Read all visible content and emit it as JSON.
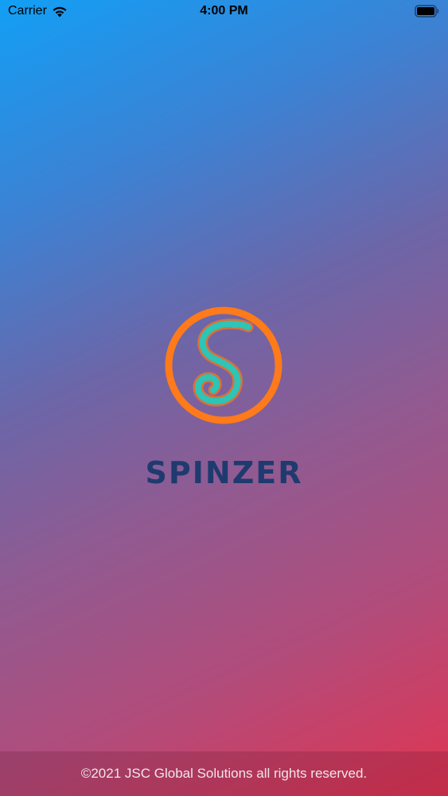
{
  "status_bar": {
    "carrier": "Carrier",
    "time": "4:00 PM",
    "icons": [
      "wifi-icon",
      "battery-icon"
    ]
  },
  "brand": {
    "name": "SPINZER",
    "logo_icon": "spinzer-s-logo",
    "logo_ring_color": "#ff7a1a",
    "logo_letter_color": "#2ec4b6",
    "name_color": "#1f3a6e"
  },
  "footer": {
    "copyright": "©2021 JSC Global Solutions all rights reserved."
  },
  "colors": {
    "gradient_top": "#129ff5",
    "gradient_bottom": "#e13451"
  }
}
